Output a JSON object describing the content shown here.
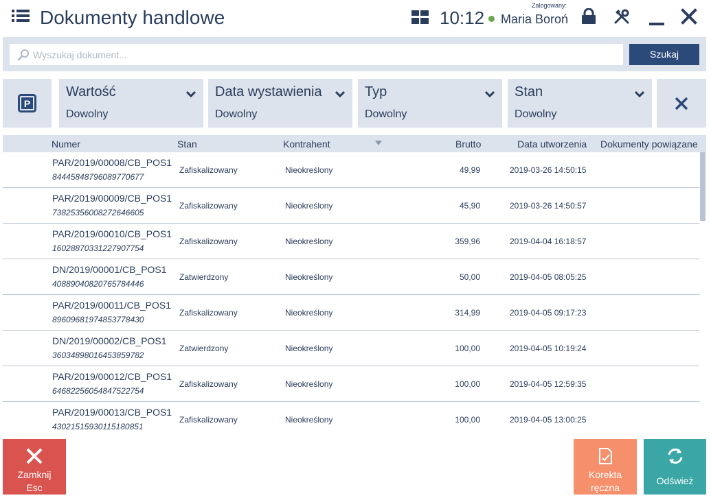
{
  "header": {
    "title": "Dokumenty handlowe",
    "clock": "10:12",
    "logged_label": "Zalogowany:",
    "user_name": "Maria Boroń"
  },
  "search": {
    "placeholder": "Wyszukaj dokument...",
    "button_label": "Szukaj"
  },
  "filters": [
    {
      "label": "Wartość",
      "value": "Dowolny"
    },
    {
      "label": "Data wystawienia",
      "value": "Dowolny"
    },
    {
      "label": "Typ",
      "value": "Dowolny"
    },
    {
      "label": "Stan",
      "value": "Dowolny"
    }
  ],
  "table": {
    "columns": [
      "Numer",
      "Stan",
      "Kontrahent",
      "Brutto",
      "Data utworzenia",
      "Dokumenty powiązane"
    ],
    "rows": [
      {
        "numer": "PAR/2019/00008/CB_POS1",
        "code": "8444584879608977067​7",
        "stan": "Zafiskalizowany",
        "kontrahent": "Nieokreślony",
        "brutto": "49,99",
        "data": "2019-03-26 14:50:15"
      },
      {
        "numer": "PAR/2019/00009/CB_POS1",
        "code": "73825356008272646605",
        "stan": "Zafiskalizowany",
        "kontrahent": "Nieokreślony",
        "brutto": "45,90",
        "data": "2019-03-26 14:50:57"
      },
      {
        "numer": "PAR/2019/00010/CB_POS1",
        "code": "16028870331227907754",
        "stan": "Zafiskalizowany",
        "kontrahent": "Nieokreślony",
        "brutto": "359,96",
        "data": "2019-04-04 16:18:57"
      },
      {
        "numer": "DN/2019/00001/CB_POS1",
        "code": "40889040820765784446",
        "stan": "Zatwierdzony",
        "kontrahent": "Nieokreślony",
        "brutto": "50,00",
        "data": "2019-04-05 08:05:25"
      },
      {
        "numer": "PAR/2019/00011/CB_POS1",
        "code": "89609681974853778430",
        "stan": "Zafiskalizowany",
        "kontrahent": "Nieokreślony",
        "brutto": "314,99",
        "data": "2019-04-05 09:17:23"
      },
      {
        "numer": "DN/2019/00002/CB_POS1",
        "code": "36034898016453859782",
        "stan": "Zatwierdzony",
        "kontrahent": "Nieokreślony",
        "brutto": "100,00",
        "data": "2019-04-05 10:19:24"
      },
      {
        "numer": "PAR/2019/00012/CB_POS1",
        "code": "64682256054847522754",
        "stan": "Zafiskalizowany",
        "kontrahent": "Nieokreślony",
        "brutto": "100,00",
        "data": "2019-04-05 12:59:35"
      },
      {
        "numer": "PAR/2019/00013/CB_POS1",
        "code": "43021515930115180851",
        "stan": "Zafiskalizowany",
        "kontrahent": "Nieokreślony",
        "brutto": "100,00",
        "data": "2019-04-05 13:00:25"
      }
    ]
  },
  "buttons": {
    "close_l1": "Zamknij",
    "close_l2": "Esc",
    "korekta_l1": "Korekta",
    "korekta_l2": "ręczna",
    "refresh": "Odśwież"
  },
  "colors": {
    "primary_text": "#2a3d5c",
    "panel": "#dde3ec",
    "search_button": "#2b4a7a",
    "close_button": "#d9534f",
    "korekta_button": "#f58f6c",
    "refresh_button": "#3aa6a6",
    "online": "#6aa84f"
  },
  "icons": [
    "menu-icon",
    "grid-icon",
    "lock-icon",
    "tools-icon",
    "minimize-icon",
    "close-icon",
    "search-icon",
    "parking-icon",
    "chevron-down-icon",
    "clear-filters-icon",
    "sort-arrow-icon",
    "document-edit-icon",
    "refresh-icon"
  ]
}
